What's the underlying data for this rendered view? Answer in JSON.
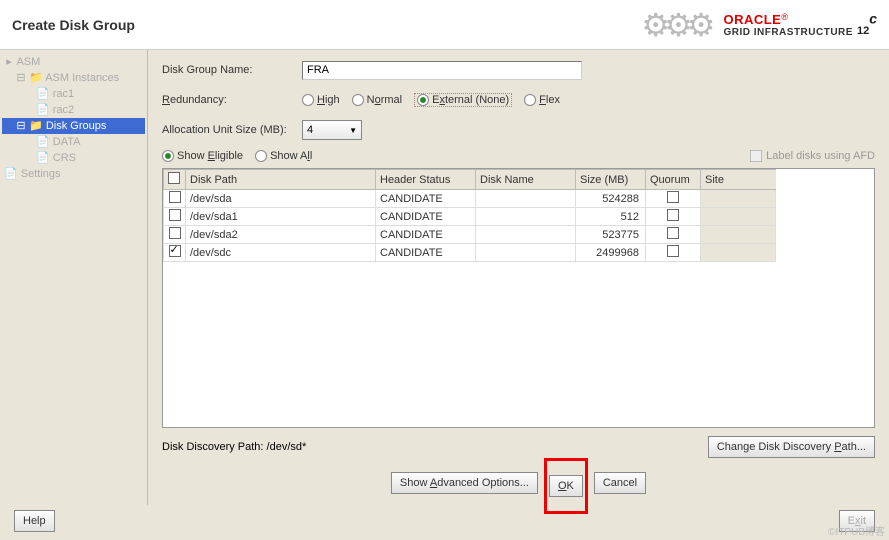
{
  "title": "Create Disk Group",
  "logo": {
    "brand": "ORACLE",
    "sub": "GRID INFRASTRUCTURE",
    "version": "12",
    "version_sup": "c"
  },
  "sidebar": {
    "items": [
      {
        "label": "ASM",
        "level": 0
      },
      {
        "label": "ASM Instances",
        "level": 1
      },
      {
        "label": "rac1",
        "level": 2
      },
      {
        "label": "rac2",
        "level": 2
      },
      {
        "label": "Disk Groups",
        "level": 1,
        "selected": true
      },
      {
        "label": "DATA",
        "level": 2
      },
      {
        "label": "CRS",
        "level": 2
      },
      {
        "label": "Settings",
        "level": 0
      }
    ]
  },
  "form": {
    "name_label": "Disk Group Name:",
    "name_value": "FRA",
    "redundancy_label": "Redundancy:",
    "redundancy": {
      "high": "High",
      "normal": "Normal",
      "external": "External (None)",
      "flex": "Flex"
    },
    "alloc_label": "Allocation Unit Size (MB):",
    "alloc_value": "4",
    "show_eligible": "Show Eligible",
    "show_all": "Show All",
    "afd_label": "Label disks using AFD"
  },
  "table": {
    "headers": {
      "path": "Disk Path",
      "status": "Header Status",
      "name": "Disk Name",
      "size": "Size (MB)",
      "quorum": "Quorum",
      "site": "Site"
    },
    "rows": [
      {
        "path": "/dev/sda",
        "status": "CANDIDATE",
        "name": "",
        "size": "524288",
        "checked": false
      },
      {
        "path": "/dev/sda1",
        "status": "CANDIDATE",
        "name": "",
        "size": "512",
        "checked": false
      },
      {
        "path": "/dev/sda2",
        "status": "CANDIDATE",
        "name": "",
        "size": "523775",
        "checked": false
      },
      {
        "path": "/dev/sdc",
        "status": "CANDIDATE",
        "name": "",
        "size": "2499968",
        "checked": true
      }
    ]
  },
  "discovery": {
    "label": "Disk Discovery Path: /dev/sd*",
    "change_btn": "Change Disk Discovery Path..."
  },
  "buttons": {
    "advanced": "Show Advanced Options...",
    "ok": "OK",
    "cancel": "Cancel",
    "help": "Help",
    "exit": "Exit"
  },
  "watermark": "©ITPUB博客"
}
